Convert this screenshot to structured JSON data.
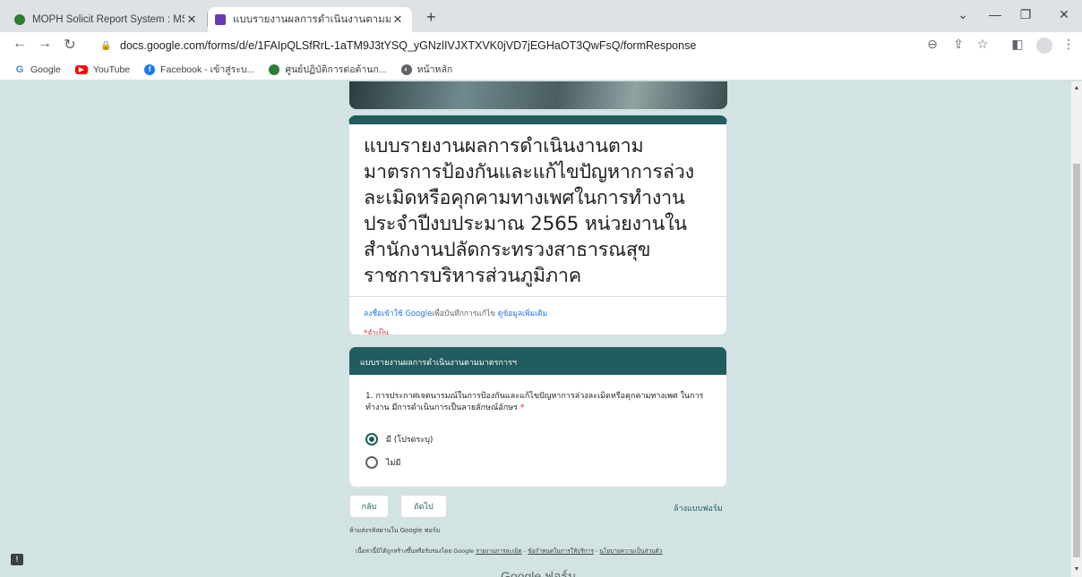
{
  "tabs": [
    {
      "title": "MOPH Solicit Report System : MS",
      "favicon_color": "#2e7d32"
    },
    {
      "title": "แบบรายงานผลการดำเนินงานตามมาตร",
      "favicon_color": "#673ab7"
    }
  ],
  "address": {
    "url": "docs.google.com/forms/d/e/1FAIpQLSfRrL-1aTM9J3tYSQ_yGNzlIVJXTXVK0jVD7jEGHaOT3QwFsQ/formResponse"
  },
  "bookmarks": [
    {
      "label": "Google",
      "color": "#4285f4"
    },
    {
      "label": "YouTube",
      "color": "#ff0000"
    },
    {
      "label": "Facebook - เข้าสู่ระบ...",
      "color": "#1877f2"
    },
    {
      "label": "ศูนย์ปฏิบัติการต่อต้านก...",
      "color": "#2e7d32"
    },
    {
      "label": "หน้าหลัก",
      "color": "#5f6368"
    }
  ],
  "form": {
    "title": "แบบรายงานผลการดำเนินงานตามมาตรการป้องกันและแก้ไขปัญหาการล่วงละเมิดหรือคุกคามทางเพศในการทำงาน ประจำปีงบประมาณ 2565 หน่วยงานในสำนักงานปลัดกระทรวงสาธารณสุข ราชการบริหารส่วนภูมิภาค",
    "signin_link": "ลงชื่อเข้าใช้ Google",
    "signin_text": "เพื่อบันทึกการแก้ไข",
    "learn_more": "ดูข้อมูลเพิ่มเติม",
    "required_note": "*จำเป็น",
    "section_title": "แบบรายงานผลการดำเนินงานตามมาตรการฯ",
    "question": "1. การประกาศเจตนารมณ์ในการป้องกันและแก้ไขปัญหาการล่วงละเมิดหรือคุกคามทางเพศ ในการทำงาน มีการดำเนินการเป็นลายลักษณ์อักษร",
    "question_required": "*",
    "options": [
      {
        "label": "มี (โปรดระบุ)",
        "checked": true
      },
      {
        "label": "ไม่มี",
        "checked": false
      }
    ],
    "back_label": "กลับ",
    "next_label": "ถัดไป",
    "clear_label": "ล้างแบบฟอร์ม",
    "never_submit": "ห้ามส่งรหัสผ่านใน Google ฟอร์ม",
    "footer_text": "เนื้อหานี้มิได้ถูกสร้างขึ้นหรือรับรองโดย Google",
    "footer_links": [
      "รายงานการละเมิด",
      "ข้อกำหนดในการให้บริการ",
      "นโยบายความเป็นส่วนตัว"
    ],
    "logo_google": "Google",
    "logo_forms": "ฟอร์ม"
  }
}
